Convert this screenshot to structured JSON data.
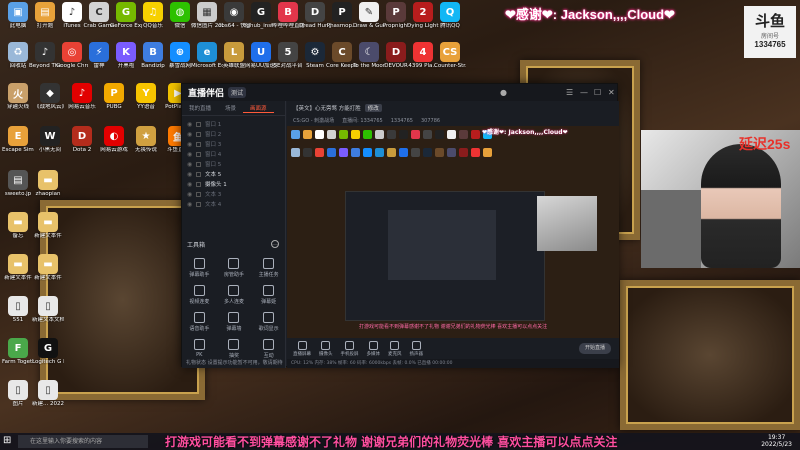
{
  "banner": {
    "text": "❤感谢❤: Jackson,,,,Cloud❤"
  },
  "room": {
    "logo": "斗鱼",
    "label": "房间号",
    "number": "1334765"
  },
  "desktop": {
    "icons": [
      {
        "label": "此电脑",
        "color": "#5aa0e6",
        "glyph": "▣"
      },
      {
        "label": "打开题",
        "color": "#e8a23a",
        "glyph": "▤"
      },
      {
        "label": "iTunes",
        "color": "#ffffff",
        "glyph": "♪"
      },
      {
        "label": "Crab Game",
        "color": "#d3d3d3",
        "glyph": "C"
      },
      {
        "label": "GeForce Experience",
        "color": "#76b900",
        "glyph": "G"
      },
      {
        "label": "QQ音乐",
        "color": "#f7d000",
        "glyph": "♫"
      },
      {
        "label": "微信",
        "color": "#2dc100",
        "glyph": "◍"
      },
      {
        "label": "微信图片 2021111...",
        "color": "#cccccc",
        "glyph": "▦"
      },
      {
        "label": "obs64 - 快捷方式",
        "color": "#3a3a3a",
        "glyph": "◉"
      },
      {
        "label": "ighub_inst...",
        "color": "#222222",
        "glyph": "G"
      },
      {
        "label": "哔哩哔哩直播姬",
        "color": "#e2364b",
        "glyph": "B"
      },
      {
        "label": "Dread Hunger",
        "color": "#444444",
        "glyph": "D"
      },
      {
        "label": "Phasmop...",
        "color": "#222222",
        "glyph": "P"
      },
      {
        "label": "Draw & Guess",
        "color": "#f0f0f0",
        "glyph": "✎"
      },
      {
        "label": "Propnight",
        "color": "#5a3a3a",
        "glyph": "P"
      },
      {
        "label": "Dying Light 2",
        "color": "#b81d1d",
        "glyph": "2"
      },
      {
        "label": "腾讯QQ",
        "color": "#12b7f5",
        "glyph": "Q"
      },
      {
        "label": "回收站",
        "color": "#9ab8d8",
        "glyph": "♻"
      },
      {
        "label": "Beyond The Wire Soun...",
        "color": "#333333",
        "glyph": "♪"
      },
      {
        "label": "Google Chrome",
        "color": "#e94235",
        "glyph": "◎"
      },
      {
        "label": "雷神",
        "color": "#2a6fdb",
        "glyph": "⚡"
      },
      {
        "label": "开黑啦",
        "color": "#7a5cff",
        "glyph": "K"
      },
      {
        "label": "Bandizip",
        "color": "#3e7de0",
        "glyph": "B"
      },
      {
        "label": "暴雪战网",
        "color": "#148eff",
        "glyph": "⊕"
      },
      {
        "label": "Microsoft Edge",
        "color": "#1e8fd6",
        "glyph": "e"
      },
      {
        "label": "英雄联盟",
        "color": "#c89b3c",
        "glyph": "L"
      },
      {
        "label": "网易UU加速器",
        "color": "#1f6feb",
        "glyph": "U"
      },
      {
        "label": "5E对战平台",
        "color": "#444444",
        "glyph": "5"
      },
      {
        "label": "Steam",
        "color": "#1b2838",
        "glyph": "⚙"
      },
      {
        "label": "Core Keeper 测试...",
        "color": "#6b4a2a",
        "glyph": "C"
      },
      {
        "label": "To the Moon",
        "color": "#4b4b6b",
        "glyph": "☾"
      },
      {
        "label": "DEVOUR",
        "color": "#8a1c1c",
        "glyph": "D"
      },
      {
        "label": "4399 Pla...",
        "color": "#e33",
        "glyph": "4"
      },
      {
        "label": "Counter-Str... Global Offe...",
        "color": "#e8a13a",
        "glyph": "CS"
      },
      {
        "label": "穿越火线",
        "color": "#c9a06a",
        "glyph": "火"
      },
      {
        "label": "《战地风云》",
        "color": "#333333",
        "glyph": "◆"
      },
      {
        "label": "网易云音乐",
        "color": "#e20000",
        "glyph": "♪"
      },
      {
        "label": "PUBG",
        "color": "#f2a900",
        "glyph": "P"
      },
      {
        "label": "YY语音",
        "color": "#f7c400",
        "glyph": "Y"
      },
      {
        "label": "PotPlayer",
        "color": "#f2c200",
        "glyph": "▶"
      },
      {
        "label": "Escape Simulator",
        "color": "#e8a13a",
        "glyph": "E"
      },
      {
        "label": "小黑无间",
        "color": "#222222",
        "glyph": "W"
      },
      {
        "label": "Dota 2",
        "color": "#b42c1c",
        "glyph": "D"
      },
      {
        "label": "网易云游戏",
        "color": "#e20000",
        "glyph": "◐"
      },
      {
        "label": "无畏传说",
        "color": "#d0a040",
        "glyph": "★"
      },
      {
        "label": "斗鱼直播",
        "color": "#ff7a00",
        "glyph": "鱼"
      },
      {
        "label": "sweeto.jp",
        "color": "#555555",
        "glyph": "▤"
      },
      {
        "label": "zhaopian",
        "color": "#e8c26a",
        "glyph": "▬"
      },
      {
        "label": "备忘",
        "color": "#e8c26a",
        "glyph": "▬"
      },
      {
        "label": "新建文本件",
        "color": "#e8c26a",
        "glyph": "▬"
      },
      {
        "label": "新建文本件",
        "color": "#e8c26a",
        "glyph": "▬"
      },
      {
        "label": "新建文本件",
        "color": "#e8c26a",
        "glyph": "▬"
      },
      {
        "label": "551",
        "color": "#e8e8e8",
        "glyph": "▯"
      },
      {
        "label": "新建文本文档 (3)",
        "color": "#e8e8e8",
        "glyph": "▯"
      },
      {
        "label": "Farm Together",
        "color": "#4aa84a",
        "glyph": "F"
      },
      {
        "label": "Logitech G HUB",
        "color": "#111111",
        "glyph": "G"
      },
      {
        "label": "图片",
        "color": "#e8e8e8",
        "glyph": "▯"
      },
      {
        "label": "新建... 2022年5...",
        "color": "#e8e8e8",
        "glyph": "▯"
      }
    ]
  },
  "app": {
    "title": "直播伴侣",
    "version": "测试",
    "tabs": [
      "我的直播",
      "场景",
      "画面源"
    ],
    "active_tab": 2,
    "scenes": [
      {
        "label": "窗口 1",
        "active": false
      },
      {
        "label": "窗口 2",
        "active": false
      },
      {
        "label": "窗口 3",
        "active": false
      },
      {
        "label": "窗口 4",
        "active": false
      },
      {
        "label": "窗口 5",
        "active": false
      },
      {
        "label": "文本 5",
        "active": true
      },
      {
        "label": "摄像头 1",
        "active": true
      },
      {
        "label": "文本 3",
        "active": false
      },
      {
        "label": "文本 4",
        "active": false
      }
    ],
    "toolbox_title": "工具箱",
    "tools": [
      {
        "label": "弹幕助手"
      },
      {
        "label": "房管助手"
      },
      {
        "label": "主播任务"
      },
      {
        "label": "视频连麦"
      },
      {
        "label": "多人连麦"
      },
      {
        "label": "弹幕姬"
      },
      {
        "label": "语音助手"
      },
      {
        "label": "弹幕墙"
      },
      {
        "label": "歌词显示"
      },
      {
        "label": "PK"
      },
      {
        "label": "抽奖"
      },
      {
        "label": "互动"
      }
    ],
    "footer": "礼物状态  设置提示功能暂不可用，敬请期待",
    "stream_title": "【英文】心无旁骛 方能打胜",
    "stream_badge": "修改",
    "stream_sub": [
      "CS:GO - 刺激战场",
      "直播间: 1334765",
      "1334765",
      "307786"
    ],
    "preview_banner": "❤感谢❤: Jackson,,,,Cloud❤",
    "preview_caption": "打游戏可能看不到弹幕感谢不了礼物 谢谢兄弟们的礼物荧光棒  喜欢主播可以点点关注",
    "bottom_tools": [
      {
        "label": "直播屏幕"
      },
      {
        "label": "摄像头"
      },
      {
        "label": "手机投屏"
      },
      {
        "label": "多媒体"
      },
      {
        "label": "麦克风"
      },
      {
        "label": "扬声器"
      }
    ],
    "start_label": "开始直播",
    "status_text": "CPU: 12%  内存: 38%  帧率: 60  码率: 6000kbps  丢帧: 0.0%  已直播 00:00:00"
  },
  "webcam": {
    "delay_text": "延迟25s"
  },
  "caption": {
    "text": "打游戏可能看不到弹幕感谢不了礼物 谢谢兄弟们的礼物荧光棒  喜欢主播可以点点关注"
  },
  "taskbar": {
    "search_placeholder": "在这里输入你要搜索的内容",
    "time": "19:37",
    "date": "2022/5/23"
  }
}
